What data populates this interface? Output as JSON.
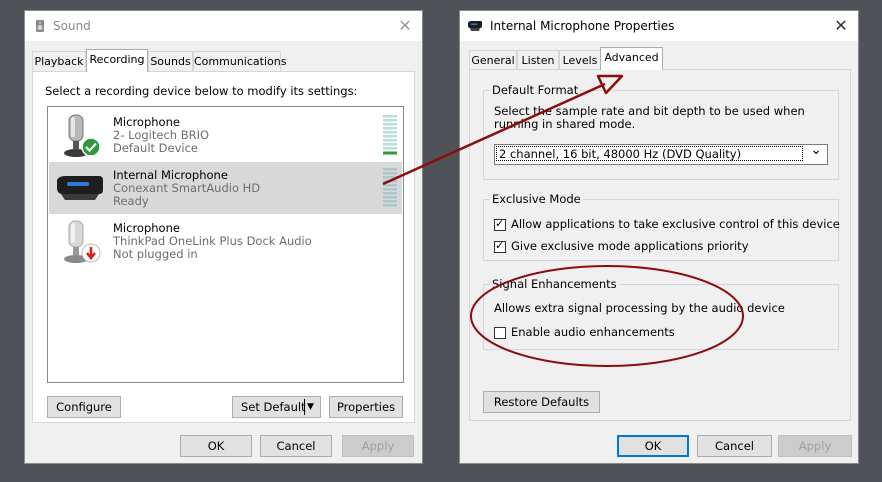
{
  "sound": {
    "title": "Sound",
    "close": "✕",
    "tabs": [
      "Playback",
      "Recording",
      "Sounds",
      "Communications"
    ],
    "instruction": "Select a recording device below to modify its settings:",
    "devices": [
      {
        "name": "Microphone",
        "sub": "2- Logitech BRIO",
        "status": "Default Device"
      },
      {
        "name": "Internal Microphone",
        "sub": "Conexant SmartAudio HD",
        "status": "Ready"
      },
      {
        "name": "Microphone",
        "sub": "ThinkPad OneLink Plus Dock Audio",
        "status": "Not plugged in"
      }
    ],
    "configure": "Configure",
    "set_default": "Set Default",
    "set_default_arrow": "▼",
    "properties": "Properties",
    "ok": "OK",
    "cancel": "Cancel",
    "apply": "Apply"
  },
  "props": {
    "title": "Internal Microphone Properties",
    "close": "✕",
    "tabs": [
      "General",
      "Listen",
      "Levels",
      "Advanced"
    ],
    "default_format": {
      "label": "Default Format",
      "description": "Select the sample rate and bit depth to be used when running in shared mode.",
      "selected": "2 channel, 16 bit, 48000 Hz (DVD Quality)",
      "chevron": "⌄"
    },
    "exclusive_mode": {
      "label": "Exclusive Mode",
      "allow": "Allow applications to take exclusive control of this device",
      "priority": "Give exclusive mode applications priority",
      "check": "✓"
    },
    "signal": {
      "label": "Signal Enhancements",
      "description": "Allows extra signal processing by the audio device",
      "enable": "Enable audio enhancements"
    },
    "restore": "Restore Defaults",
    "ok": "OK",
    "cancel": "Cancel",
    "apply": "Apply"
  },
  "colors": {
    "annotation": "#8b0d0d",
    "accent": "#0078d7",
    "meter_active": "#2e9a3e"
  }
}
